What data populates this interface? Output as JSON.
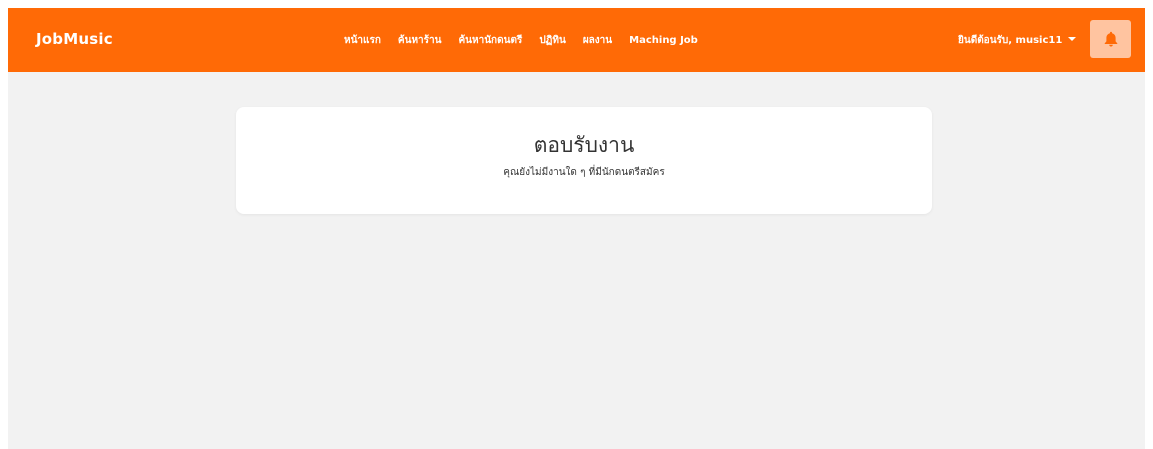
{
  "navbar": {
    "brand": "JobMusic",
    "links": [
      "หน้าแรก",
      "ค้นหาร้าน",
      "ค้นหานักดนตรี",
      "ปฏิทิน",
      "ผลงาน",
      "Maching Job"
    ],
    "user_greeting": "ยินดีต้อนรับ, music11",
    "bell_icon": "bell-icon",
    "background_color": "#ff6a06",
    "bell_button_color": "#ffc4a0"
  },
  "main": {
    "card": {
      "title": "ตอบรับงาน",
      "message": "คุณยังไม่มีงานใด ๆ ที่มีนักดนตรีสมัคร"
    }
  }
}
